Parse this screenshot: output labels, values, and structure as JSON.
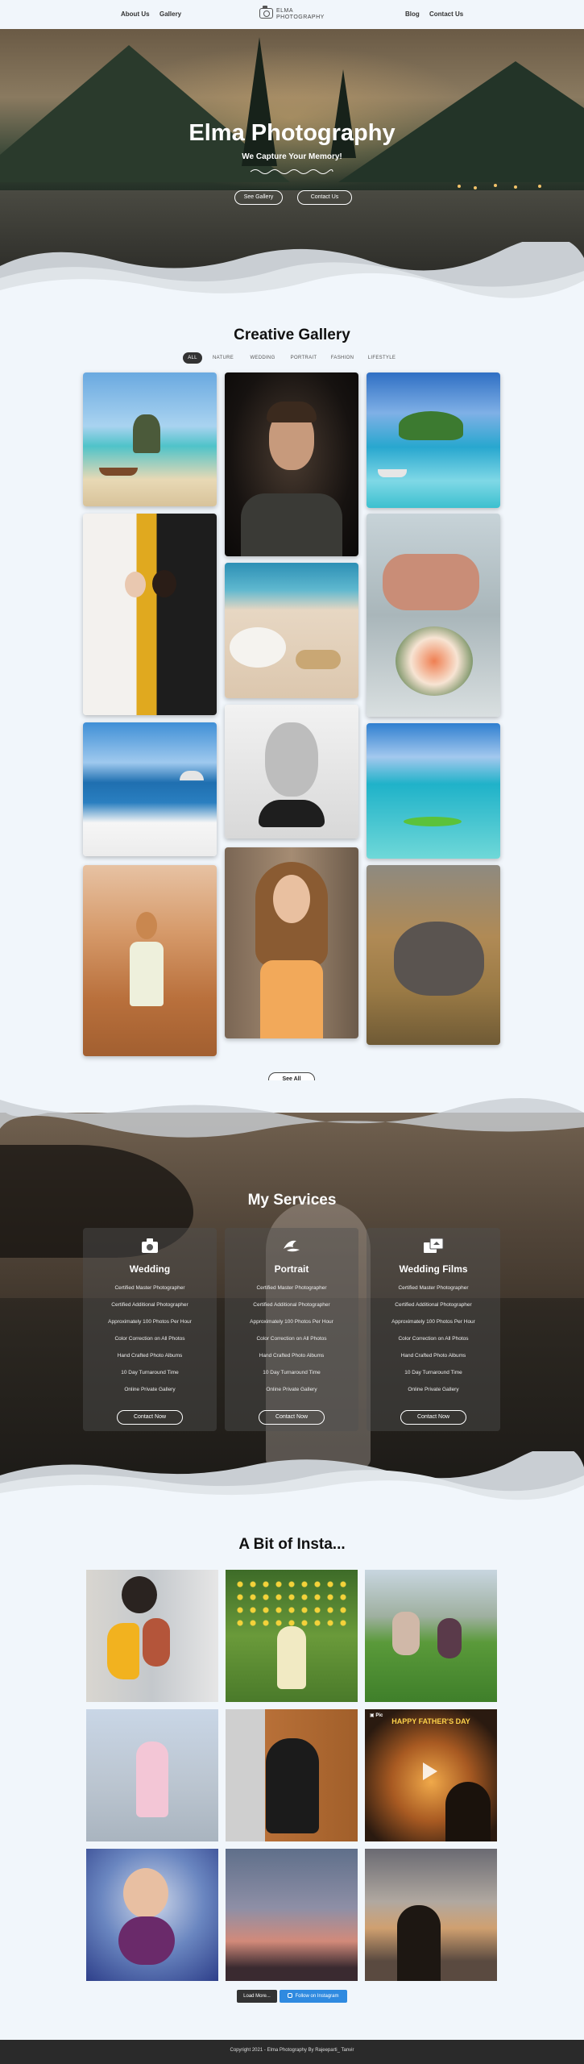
{
  "nav": {
    "about": "About Us",
    "gallery": "Gallery",
    "blog": "Blog",
    "contact": "Contact Us",
    "logo_line1": "ELMA",
    "logo_line2": "PHOTOGRAPHY"
  },
  "hero": {
    "title": "Elma Photography",
    "subtitle": "We Capture Your Memory!",
    "btn_gallery": "See Gallery",
    "btn_contact": "Contact Us"
  },
  "gallery": {
    "title": "Creative Gallery",
    "filters": [
      "ALL",
      "NATURE",
      "WEDDING",
      "PORTRAIT",
      "FASHION",
      "LIFESTYLE"
    ],
    "active_filter": "ALL",
    "see_all": "See All"
  },
  "services": {
    "title": "My Services",
    "cards": [
      {
        "name": "Wedding",
        "icon": "camera-icon",
        "features": [
          "Certified Master Photographer",
          "Certified Additional Photographer",
          "Approximately 100 Photos Per Hour",
          "Color Correction on All Photos",
          "Hand Crafted Photo Albums",
          "10 Day Turnaround Time",
          "Online Private Gallery"
        ],
        "button": "Contact Now"
      },
      {
        "name": "Portrait",
        "icon": "portrait-icon",
        "features": [
          "Certified Master Photographer",
          "Certified Additional Photographer",
          "Approximately 100 Photos Per Hour",
          "Color Correction on All Photos",
          "Hand Crafted Photo Albums",
          "10 Day Turnaround Time",
          "Online Private Gallery"
        ],
        "button": "Contact Now"
      },
      {
        "name": "Wedding Films",
        "icon": "film-icon",
        "features": [
          "Certified Master Photographer",
          "Certified Additional Photographer",
          "Approximately 100 Photos Per Hour",
          "Color Correction on All Photos",
          "Hand Crafted Photo Albums",
          "10 Day Turnaround Time",
          "Online Private Gallery"
        ],
        "button": "Contact Now"
      }
    ]
  },
  "insta": {
    "title": "A Bit of Insta...",
    "load_more": "Load More...",
    "follow": "Follow on Instagram",
    "card6_caption": "HAPPY FATHER'S DAY"
  },
  "footer": {
    "copyright": "Copyright 2021 - Elma Photography By Rajeeparti_ Tanvir"
  }
}
